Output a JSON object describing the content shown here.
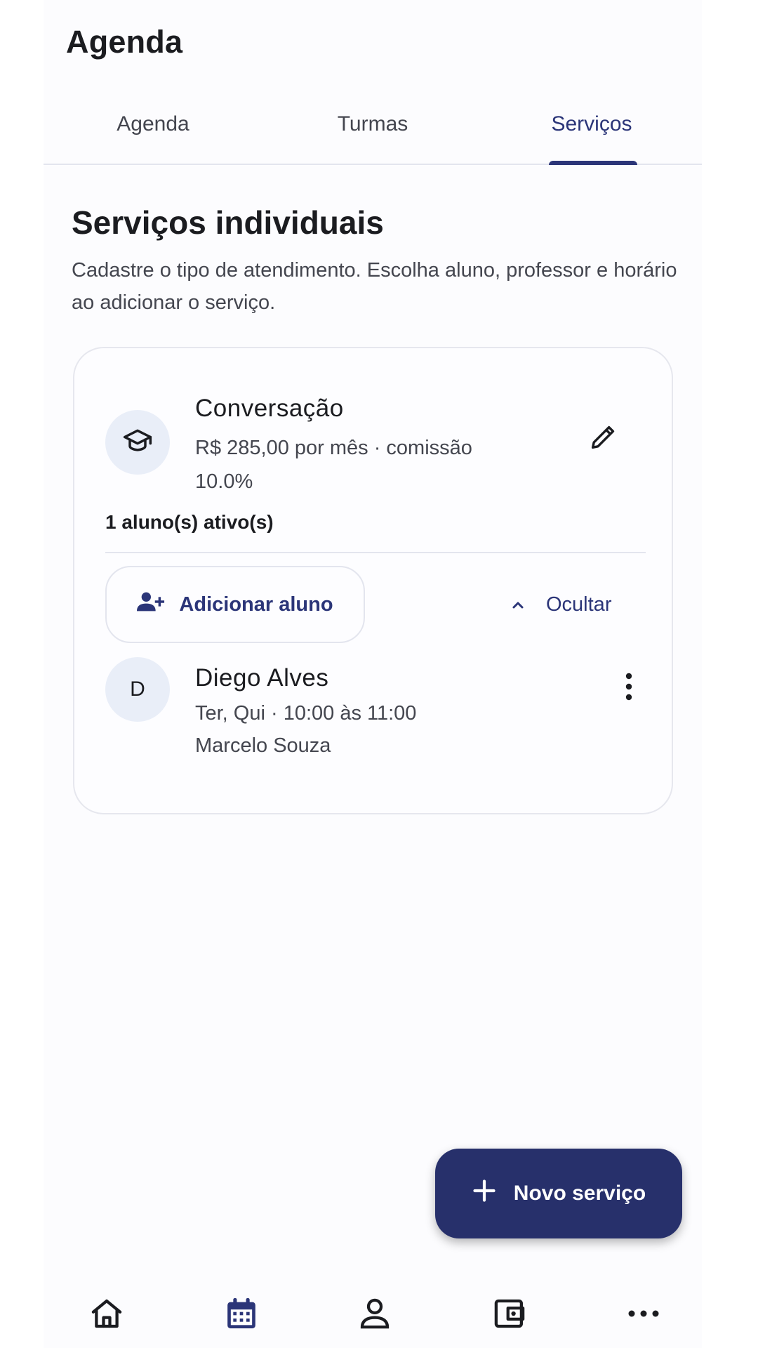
{
  "app": {
    "title": "Agenda"
  },
  "tabs": [
    {
      "label": "Agenda",
      "selected": false
    },
    {
      "label": "Turmas",
      "selected": false
    },
    {
      "label": "Serviços",
      "selected": true
    }
  ],
  "section": {
    "title": "Serviços individuais",
    "description": "Cadastre o tipo de atendimento. Escolha aluno, professor e horário ao adicionar o serviço."
  },
  "service": {
    "icon": "graduation-cap-icon",
    "name": "Conversação",
    "info": "R$ 285,00 por mês · comissão 10.0%",
    "active_count": "1 aluno(s) ativo(s)",
    "add_student_label": "Adicionar aluno",
    "hide_label": "Ocultar",
    "students": [
      {
        "initial": "D",
        "name": "Diego Alves",
        "schedule": "Ter, Qui · 10:00 às 11:00",
        "teacher": "Marcelo Souza"
      }
    ]
  },
  "fab": {
    "label": "Novo serviço"
  },
  "bottom_nav": [
    {
      "icon": "home-icon",
      "selected": false
    },
    {
      "icon": "calendar-icon",
      "selected": true
    },
    {
      "icon": "person-icon",
      "selected": false
    },
    {
      "icon": "wallet-icon",
      "selected": false
    },
    {
      "icon": "more-horizontal-icon",
      "selected": false
    }
  ],
  "colors": {
    "primary": "#2b3578",
    "fab_background": "#27306b",
    "avatar_background": "#e9eef8",
    "text_primary": "#1b1c20",
    "text_secondary": "#44464f"
  }
}
